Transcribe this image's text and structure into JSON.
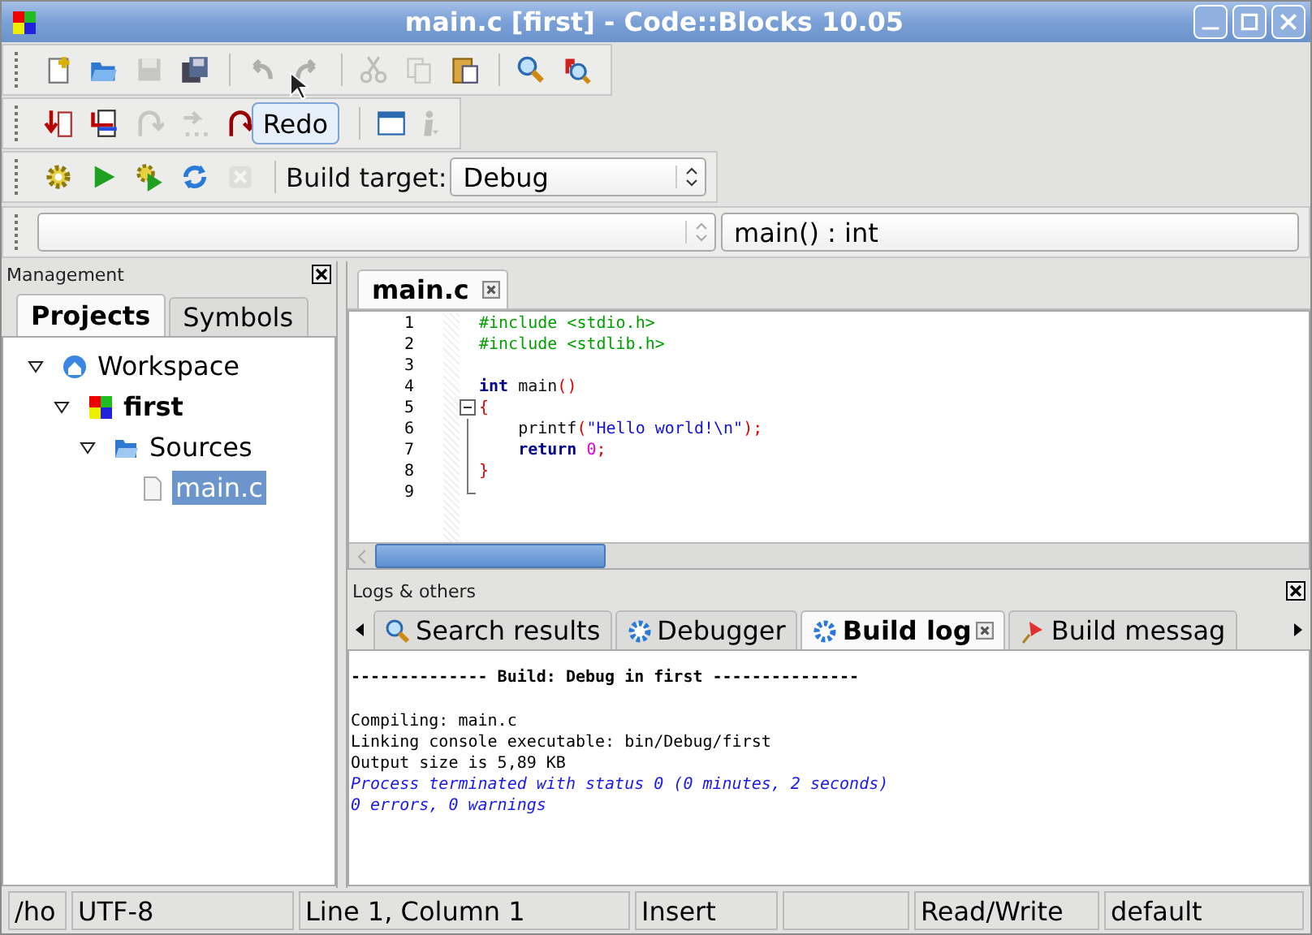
{
  "window": {
    "title": "main.c [first] - Code::Blocks 10.05"
  },
  "toolbars": [
    {
      "groups": [
        [
          {
            "kind": "new",
            "disabled": false
          },
          {
            "kind": "open",
            "disabled": false
          },
          {
            "kind": "save",
            "disabled": true
          },
          {
            "kind": "saveall",
            "disabled": false
          }
        ],
        [
          {
            "kind": "undo",
            "disabled": true
          },
          {
            "kind": "redo",
            "disabled": true
          }
        ],
        [
          {
            "kind": "cut",
            "disabled": true
          },
          {
            "kind": "copy",
            "disabled": true
          },
          {
            "kind": "paste",
            "disabled": false
          }
        ],
        [
          {
            "kind": "find",
            "disabled": false
          },
          {
            "kind": "replace",
            "disabled": false
          }
        ]
      ]
    },
    {
      "groups": [
        [
          {
            "kind": "runto",
            "disabled": false
          },
          {
            "kind": "nextline",
            "disabled": false
          },
          {
            "kind": "stepin",
            "disabled": true
          },
          {
            "kind": "stepover",
            "disabled": true
          },
          {
            "kind": "stepout",
            "disabled": false
          }
        ],
        [
          {
            "kind": "window",
            "disabled": false
          },
          {
            "kind": "info",
            "disabled": true
          }
        ]
      ]
    },
    {
      "groups": [
        [
          {
            "kind": "build",
            "disabled": false
          },
          {
            "kind": "run",
            "disabled": false
          },
          {
            "kind": "buildrun",
            "disabled": false
          },
          {
            "kind": "rebuild",
            "disabled": false
          },
          {
            "kind": "abort",
            "disabled": true
          }
        ]
      ],
      "label": "Build target:",
      "select": "Debug"
    }
  ],
  "tooltip": {
    "text": "Redo"
  },
  "code_bar": {
    "function": "main() : int"
  },
  "management": {
    "title": "Management",
    "tabs": [
      {
        "label": "Projects",
        "selected": true
      },
      {
        "label": "Symbols",
        "selected": false
      }
    ],
    "tree": [
      {
        "label": "Workspace",
        "kind": "workspace",
        "active": false,
        "selected": false,
        "expanded": true,
        "children": [
          {
            "label": "first",
            "kind": "project",
            "active": true,
            "selected": false,
            "expanded": true,
            "children": [
              {
                "label": "Sources",
                "kind": "folder",
                "active": false,
                "selected": false,
                "expanded": true,
                "children": [
                  {
                    "label": "main.c",
                    "kind": "file",
                    "active": false,
                    "selected": true
                  }
                ]
              }
            ]
          }
        ]
      }
    ]
  },
  "editor": {
    "tabs": [
      {
        "label": "main.c",
        "selected": true
      }
    ],
    "lines": [
      {
        "number": "1",
        "kind": "plain",
        "tokens": [
          {
            "kind": "pre",
            "text": "#include <stdio.h>"
          }
        ]
      },
      {
        "number": "2",
        "kind": "plain",
        "tokens": [
          {
            "kind": "pre",
            "text": "#include <stdlib.h>"
          }
        ]
      },
      {
        "number": "3",
        "kind": "plain"
      },
      {
        "number": "4",
        "kind": "plain",
        "tokens": [
          {
            "kind": "keyword",
            "text": "int"
          },
          {
            "kind": "plain",
            "text": " main"
          },
          {
            "kind": "op",
            "text": "()"
          }
        ]
      },
      {
        "number": "5",
        "kind": "fold-start",
        "tokens": [
          {
            "kind": "op",
            "text": "{"
          }
        ]
      },
      {
        "number": "6",
        "kind": "fold-body",
        "tokens": [
          {
            "kind": "plain",
            "text": "    printf"
          },
          {
            "kind": "op",
            "text": "("
          },
          {
            "kind": "string",
            "text": "\"Hello world!\\n\""
          },
          {
            "kind": "op",
            "text": ");"
          }
        ]
      },
      {
        "number": "7",
        "kind": "fold-body",
        "tokens": [
          {
            "kind": "keyword",
            "text": "    return"
          },
          {
            "kind": "number",
            "text": " 0"
          },
          {
            "kind": "op",
            "text": ";"
          }
        ]
      },
      {
        "number": "8",
        "kind": "fold-body",
        "tokens": [
          {
            "kind": "op",
            "text": "}"
          }
        ]
      },
      {
        "number": "9",
        "kind": "fold-end"
      }
    ]
  },
  "logs": {
    "title": "Logs & others",
    "tabs": [
      {
        "label": "Search results",
        "kind": "search",
        "selected": false
      },
      {
        "label": "Debugger",
        "kind": "gear",
        "selected": false
      },
      {
        "label": "Build log",
        "kind": "gear",
        "selected": true
      },
      {
        "label": "Build messag",
        "kind": "pin",
        "selected": false
      }
    ],
    "lines": [
      {
        "kind": "blank"
      },
      {
        "kind": "header",
        "text": "-------------- Build: Debug in first ---------------"
      },
      {
        "kind": "blank"
      },
      {
        "kind": "normal",
        "text": "Compiling: main.c"
      },
      {
        "kind": "normal",
        "text": "Linking console executable: bin/Debug/first"
      },
      {
        "kind": "normal",
        "text": "Output size is 5,89 KB"
      },
      {
        "kind": "info",
        "text": "Process terminated with status 0 (0 minutes, 2 seconds)"
      },
      {
        "kind": "info",
        "text": "0 errors, 0 warnings"
      }
    ]
  },
  "status_bar": [
    {
      "kind": "text",
      "text": "/ho"
    },
    {
      "kind": "text",
      "text": "UTF-8"
    },
    {
      "kind": "text",
      "text": "Line 1, Column 1"
    },
    {
      "kind": "text",
      "text": "Insert"
    },
    {
      "kind": "empty"
    },
    {
      "kind": "text",
      "text": "Read/Write"
    },
    {
      "kind": "text",
      "text": "default"
    }
  ]
}
